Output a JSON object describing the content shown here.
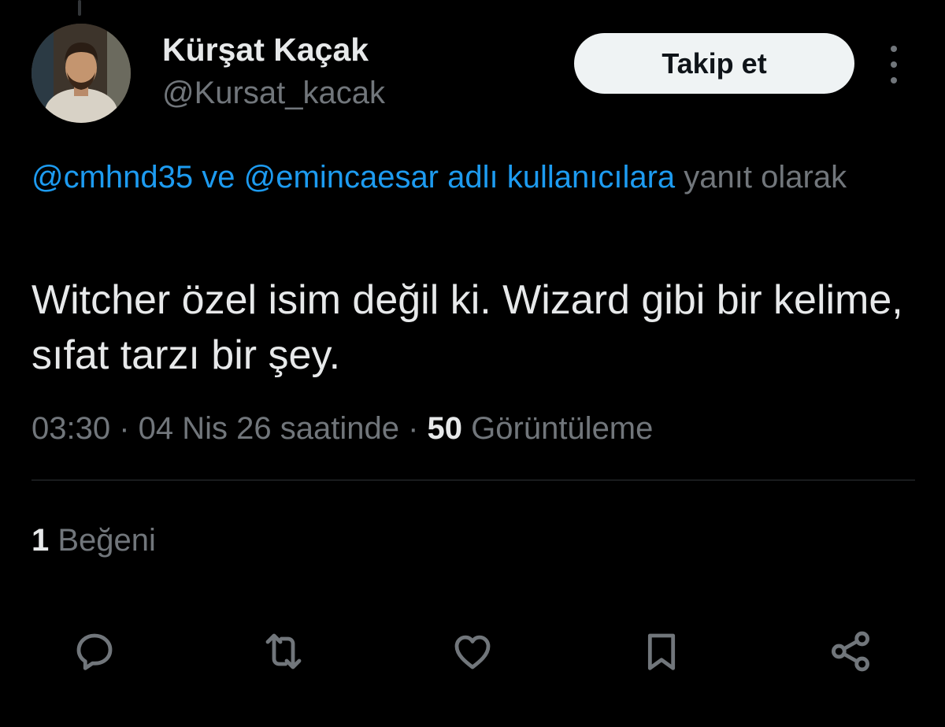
{
  "tweet": {
    "author": {
      "display_name": "Kürşat Kaçak",
      "handle": "@Kursat_kacak"
    },
    "follow_label": "Takip et",
    "reply_context": {
      "mention_1": "@cmhnd35",
      "connector": " ve ",
      "mention_2": "@emincaesar adlı kullanıcılara",
      "suffix": " yanıt olarak"
    },
    "text": "Witcher özel isim değil ki. Wizard gibi bir kelime, sıfat tarzı bir şey.",
    "meta": {
      "time": "03:30",
      "separator_1": " · ",
      "date": "04 Nis 26 saatinde",
      "separator_2": " · ",
      "views_count": "50",
      "views_label": " Görüntüleme"
    },
    "likes": {
      "count": "1",
      "label": " Beğeni"
    }
  },
  "actions": [
    {
      "name": "reply",
      "icon": "reply-icon"
    },
    {
      "name": "retweet",
      "icon": "retweet-icon"
    },
    {
      "name": "like",
      "icon": "heart-icon"
    },
    {
      "name": "bookmark",
      "icon": "bookmark-icon"
    },
    {
      "name": "share",
      "icon": "share-icon"
    }
  ],
  "colors": {
    "background": "#000000",
    "primary_text": "#e7e9ea",
    "secondary_text": "#71767b",
    "link": "#1d9bf0",
    "follow_button_bg": "#eff3f4",
    "follow_button_text": "#0f1419",
    "divider": "#2f3336"
  }
}
